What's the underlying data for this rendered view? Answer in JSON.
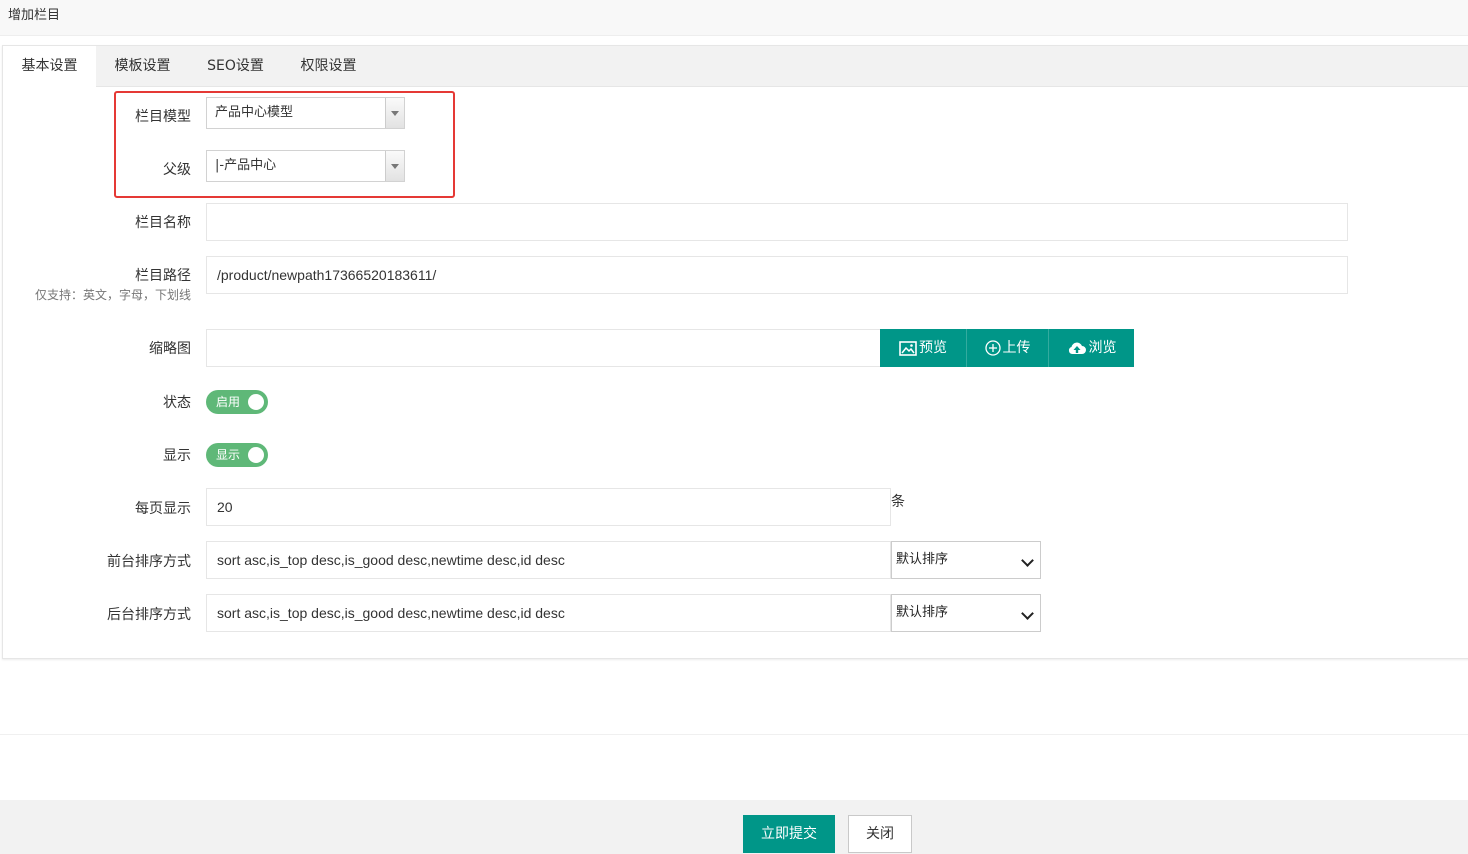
{
  "page": {
    "title": "增加栏目"
  },
  "tabs": [
    {
      "label": "基本设置"
    },
    {
      "label": "模板设置"
    },
    {
      "label": "SEO设置"
    },
    {
      "label": "权限设置"
    }
  ],
  "form": {
    "model": {
      "label": "栏目模型",
      "value": "产品中心模型"
    },
    "parent": {
      "label": "父级",
      "value": "|-产品中心"
    },
    "name": {
      "label": "栏目名称",
      "value": ""
    },
    "path": {
      "label": "栏目路径",
      "hint": "仅支持：英文，字母，下划线",
      "value": "/product/newpath17366520183611/"
    },
    "thumb": {
      "label": "缩略图",
      "value": "",
      "buttons": {
        "preview": "预览",
        "upload": "上传",
        "browse": "浏览"
      }
    },
    "status": {
      "label": "状态",
      "switch_text": "启用",
      "on": true
    },
    "display": {
      "label": "显示",
      "switch_text": "显示",
      "on": true
    },
    "per_page": {
      "label": "每页显示",
      "value": "20",
      "unit": "条"
    },
    "front_sort": {
      "label": "前台排序方式",
      "value": "sort asc,is_top desc,is_good desc,newtime desc,id desc",
      "select": "默认排序"
    },
    "back_sort": {
      "label": "后台排序方式",
      "value": "sort asc,is_top desc,is_good desc,newtime desc,id desc",
      "select": "默认排序"
    }
  },
  "footer": {
    "submit": "立即提交",
    "close": "关闭"
  },
  "colors": {
    "primary": "#009688",
    "switch_on": "#5fb878",
    "highlight": "#e53935"
  }
}
